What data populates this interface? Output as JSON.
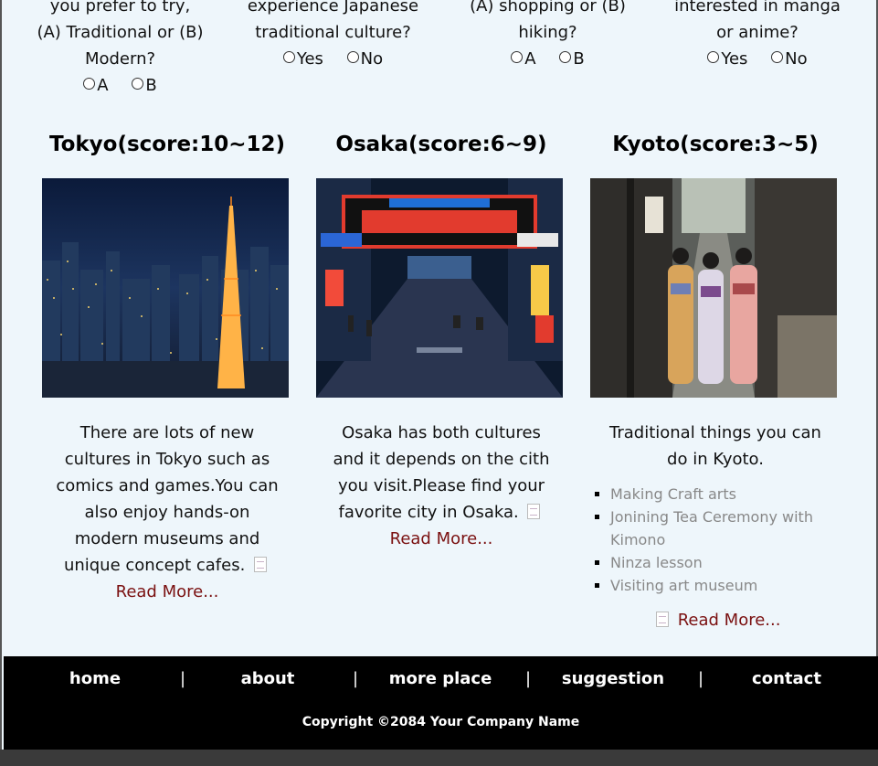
{
  "quiz": [
    {
      "lines": [
        "you prefer to try,",
        "(A) Traditional or (B)",
        "Modern?"
      ],
      "options": [
        "A",
        "B"
      ]
    },
    {
      "lines": [
        "experience Japanese",
        "traditional culture?"
      ],
      "options": [
        "Yes",
        "No"
      ]
    },
    {
      "lines": [
        "(A) shopping or (B)",
        "hiking?"
      ],
      "options": [
        "A",
        "B"
      ]
    },
    {
      "lines": [
        "interested in manga",
        "or anime?"
      ],
      "options": [
        "Yes",
        "No"
      ]
    }
  ],
  "cities": [
    {
      "title": "Tokyo(score:10~12)",
      "image": "tokyo-night-skyline-tower",
      "description": "There are lots of new cultures in Tokyo such as comics and games.You can also enjoy hands-on modern museums and unique concept cafes.",
      "read_more": "Read More..."
    },
    {
      "title": "Osaka(score:6~9)",
      "image": "osaka-dotonbori-street",
      "description": "Osaka has both cultures and it depends on the cith you visit.Please find your favorite city in Osaka.",
      "read_more": "Read More..."
    },
    {
      "title": "Kyoto(score:3~5)",
      "image": "kyoto-kimono-street",
      "description": "Traditional things you can do in Kyoto.",
      "list": [
        "Making Craft arts",
        "Jonining Tea Ceremony with Kimono",
        "Ninza lesson",
        "Visiting art museum"
      ],
      "read_more": "Read More..."
    }
  ],
  "footer": {
    "nav": [
      "home",
      "about",
      "more place",
      "suggestion",
      "contact"
    ],
    "separator": "|",
    "copyright": "Copyright ©2084 Your Company Name"
  },
  "colors": {
    "page_bg": "#eef6fb",
    "footer_bg": "#000000",
    "link": "#7a1010",
    "list_text": "#888888"
  }
}
